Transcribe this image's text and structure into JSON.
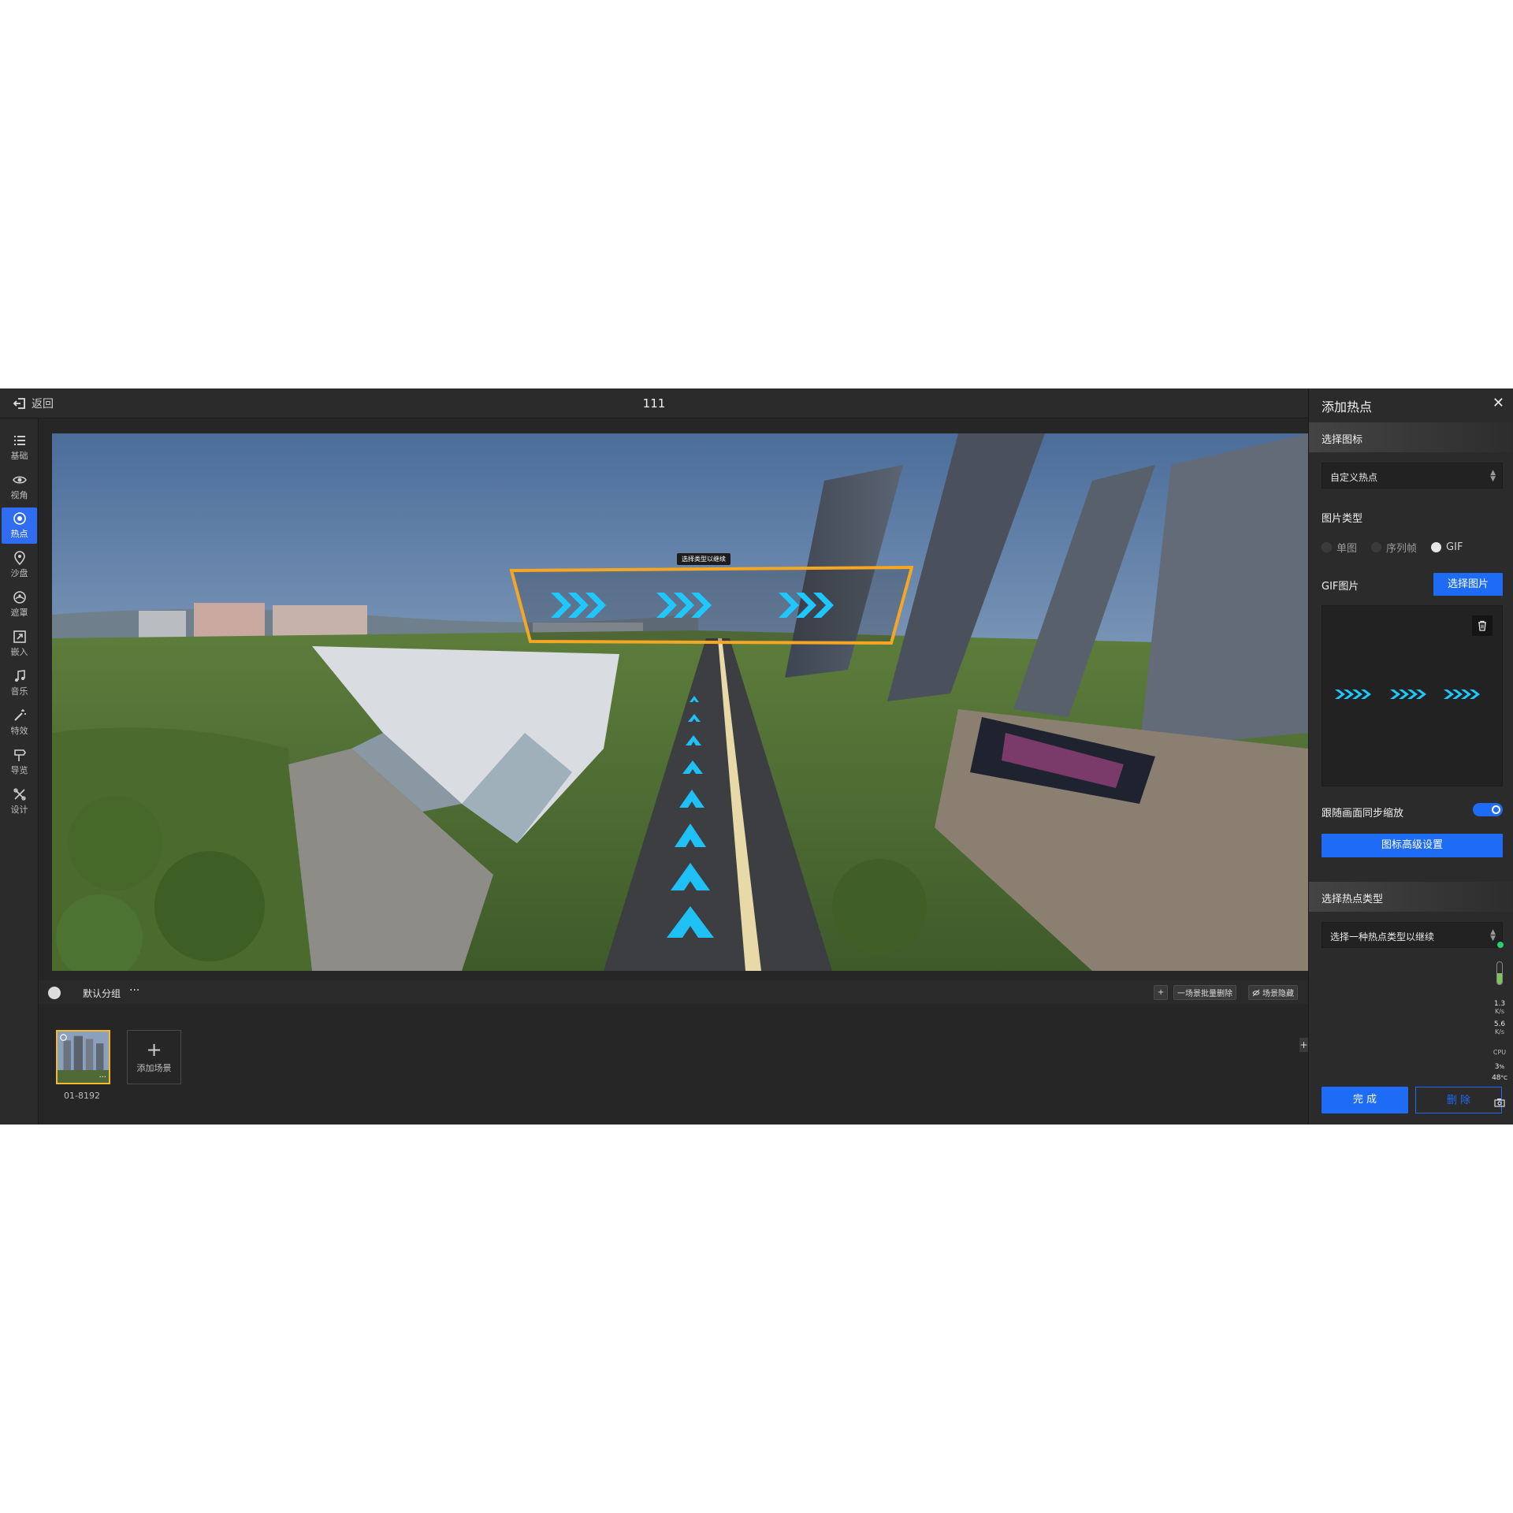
{
  "topbar": {
    "back_label": "返回",
    "title": "111"
  },
  "sidebar": {
    "items": [
      {
        "label": "基础",
        "icon": "list-icon"
      },
      {
        "label": "视角",
        "icon": "eye-icon"
      },
      {
        "label": "热点",
        "icon": "target-icon",
        "active": true
      },
      {
        "label": "沙盘",
        "icon": "map-pin-icon"
      },
      {
        "label": "遮罩",
        "icon": "mask-icon"
      },
      {
        "label": "嵌入",
        "icon": "embed-icon"
      },
      {
        "label": "音乐",
        "icon": "music-icon"
      },
      {
        "label": "特效",
        "icon": "wand-icon"
      },
      {
        "label": "导览",
        "icon": "signpost-icon"
      },
      {
        "label": "设计",
        "icon": "design-icon"
      }
    ]
  },
  "viewport": {
    "hotspot_tooltip": "选择类型以继续"
  },
  "scenebar": {
    "group_label": "默认分组",
    "more": "···",
    "batch_delete_label": "一场景批量删除",
    "hide_label": "场景隐藏",
    "add_icon_label": "+",
    "scenes": [
      {
        "label": "01-8192",
        "more": "···"
      }
    ],
    "add_scene_label": "添加场景",
    "edge_plus": "+"
  },
  "panel": {
    "title": "添加热点",
    "close": "✕",
    "section_icon": "选择图标",
    "icon_select_value": "自定义热点",
    "image_type_label": "图片类型",
    "image_types": [
      {
        "label": "单图",
        "checked": false
      },
      {
        "label": "序列帧",
        "checked": false
      },
      {
        "label": "GIF",
        "checked": true
      }
    ],
    "gif_label": "GIF图片",
    "choose_image_button": "选择图片",
    "follow_zoom_label": "跟随画面同步缩放",
    "follow_zoom_on": true,
    "advanced_button": "图标高级设置",
    "section_type": "选择热点类型",
    "type_select_placeholder": "选择一种热点类型以继续",
    "done_button": "完 成",
    "delete_button": "删 除"
  },
  "monitor": {
    "upload_value": "1.3",
    "upload_unit": "K/s",
    "download_value": "5.6",
    "download_unit": "K/s",
    "cpu_label": "CPU",
    "cpu_value": "3",
    "cpu_unit": "%",
    "temp_value": "48",
    "temp_unit": "°C"
  },
  "colors": {
    "accent": "#1e6bf5",
    "active_nav": "#2f6cf0",
    "thumb_border": "#f5b82e",
    "hotspot_frame": "#f5a623",
    "arrow": "#1ec8ff"
  }
}
